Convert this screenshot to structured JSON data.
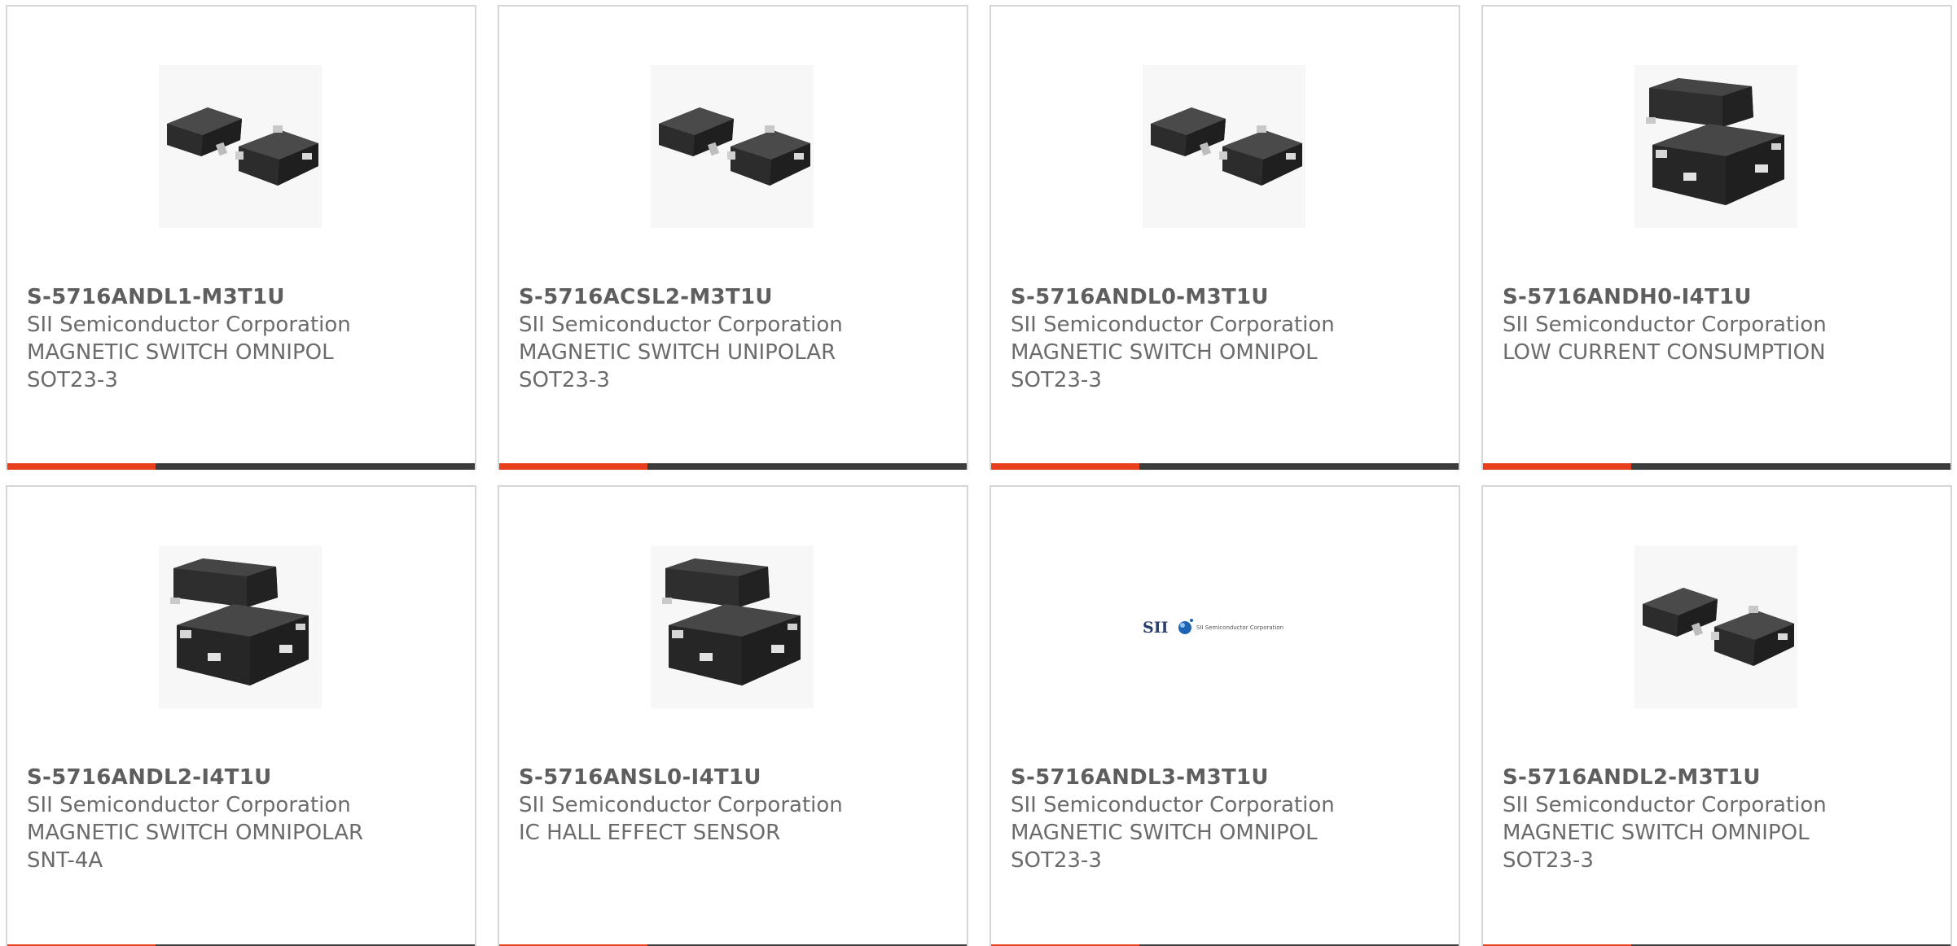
{
  "colors": {
    "accent": "#e8401c",
    "bar": "#3d3d3d",
    "text": "#6b6b6b",
    "border": "#d6d6d6"
  },
  "products": [
    {
      "part_number": "S-5716ANDL1-M3T1U",
      "manufacturer": "SII Semiconductor Corporation",
      "description": "MAGNETIC SWITCH OMNIPOL",
      "package": "SOT23-3",
      "image_icon": "sot23-package-image"
    },
    {
      "part_number": "S-5716ACSL2-M3T1U",
      "manufacturer": "SII Semiconductor Corporation",
      "description": "MAGNETIC SWITCH UNIPOLAR",
      "package": "SOT23-3",
      "image_icon": "sot23-package-image"
    },
    {
      "part_number": "S-5716ANDL0-M3T1U",
      "manufacturer": "SII Semiconductor Corporation",
      "description": "MAGNETIC SWITCH OMNIPOL",
      "package": "SOT23-3",
      "image_icon": "sot23-package-image"
    },
    {
      "part_number": "S-5716ANDH0-I4T1U",
      "manufacturer": "SII Semiconductor Corporation",
      "description": "LOW CURRENT CONSUMPTION",
      "package": "",
      "image_icon": "snt4a-package-image"
    },
    {
      "part_number": "S-5716ANDL2-I4T1U",
      "manufacturer": "SII Semiconductor Corporation",
      "description": "MAGNETIC SWITCH OMNIPOLAR",
      "package": "SNT-4A",
      "image_icon": "snt4a-package-image"
    },
    {
      "part_number": "S-5716ANSL0-I4T1U",
      "manufacturer": "SII Semiconductor Corporation",
      "description": "IC HALL EFFECT SENSOR",
      "package": "",
      "image_icon": "snt4a-package-image"
    },
    {
      "part_number": "S-5716ANDL3-M3T1U",
      "manufacturer": "SII Semiconductor Corporation",
      "description": "MAGNETIC SWITCH OMNIPOL",
      "package": "SOT23-3",
      "image_icon": "manufacturer-logo-image",
      "logo": {
        "mark": "SII",
        "text": "SII Semiconductor Corporation"
      }
    },
    {
      "part_number": "S-5716ANDL2-M3T1U",
      "manufacturer": "SII Semiconductor Corporation",
      "description": "MAGNETIC SWITCH OMNIPOL",
      "package": "SOT23-3",
      "image_icon": "sot23-package-image"
    }
  ]
}
